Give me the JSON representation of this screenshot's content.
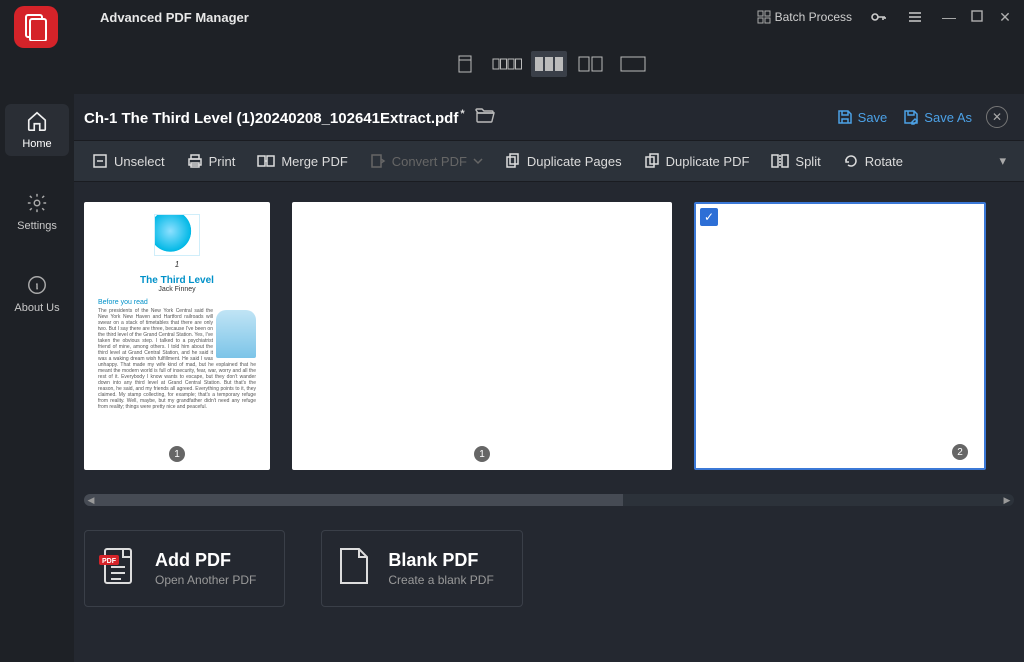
{
  "app": {
    "title": "Advanced PDF Manager",
    "batch_process": "Batch Process"
  },
  "sidebar": {
    "home": "Home",
    "settings": "Settings",
    "about": "About Us"
  },
  "document": {
    "filename": "Ch-1 The Third Level (1)20240208_102641Extract.pdf",
    "modified_marker": "*",
    "save": "Save",
    "save_as": "Save As"
  },
  "toolbar": {
    "unselect": "Unselect",
    "print": "Print",
    "merge": "Merge PDF",
    "convert": "Convert PDF",
    "dup_pages": "Duplicate Pages",
    "dup_pdf": "Duplicate PDF",
    "split": "Split",
    "rotate": "Rotate"
  },
  "pages": {
    "items": [
      {
        "number": "1",
        "selected": false,
        "kind": "content"
      },
      {
        "number": "1",
        "selected": false,
        "kind": "blank-wide"
      },
      {
        "number": "2",
        "selected": true,
        "kind": "blank-wide"
      }
    ]
  },
  "thumb_content": {
    "title": "The Third Level",
    "author": "Jack Finney",
    "before": "Before you read"
  },
  "actions": {
    "add_title": "Add PDF",
    "add_sub": "Open Another PDF",
    "blank_title": "Blank PDF",
    "blank_sub": "Create a blank PDF",
    "pdf_tag": "PDF"
  }
}
